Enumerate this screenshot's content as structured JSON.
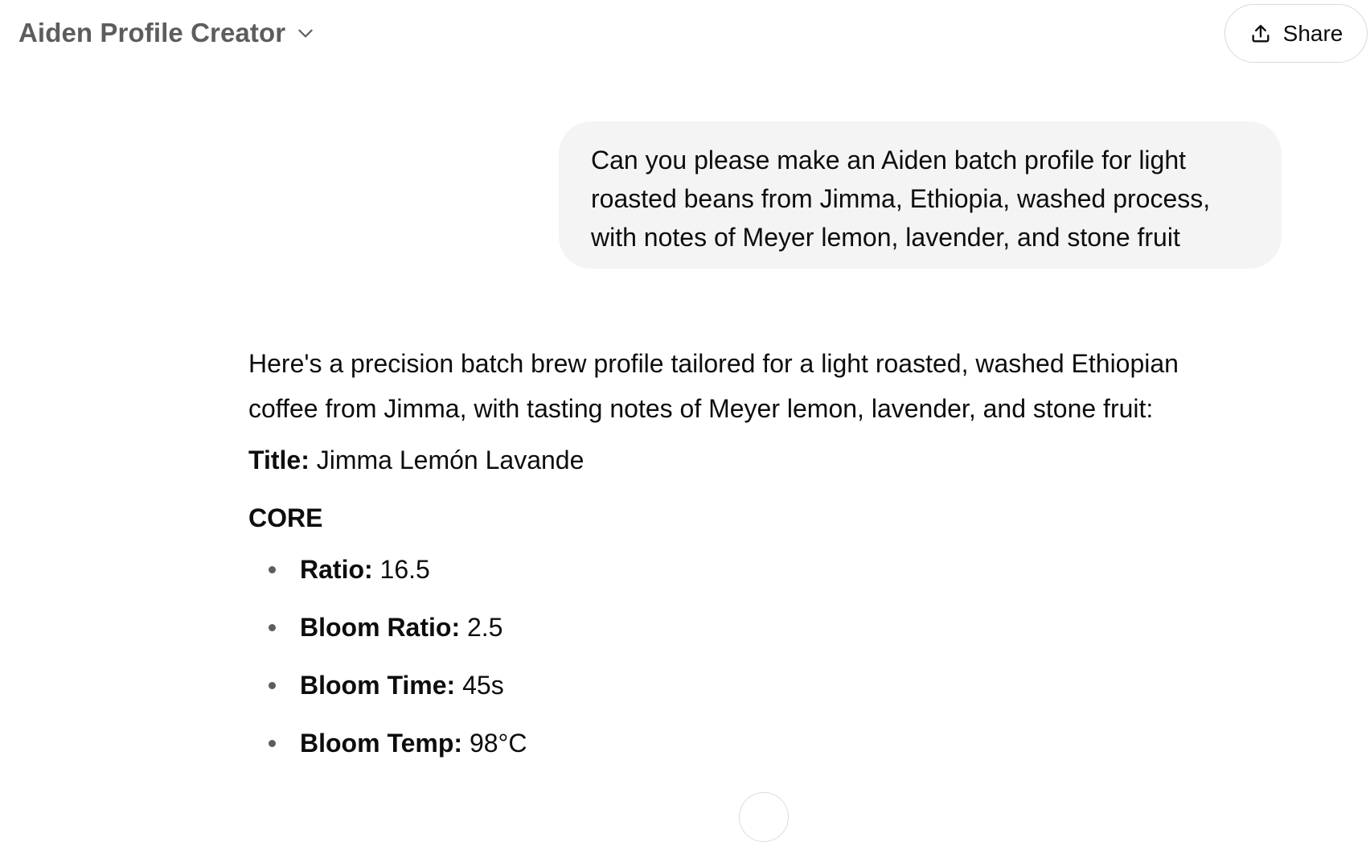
{
  "header": {
    "title": "Aiden Profile Creator",
    "share_label": "Share"
  },
  "conversation": {
    "user_message": "Can you please make an Aiden batch profile for light roasted beans from Jimma, Ethiopia, washed process, with notes of Meyer lemon, lavender, and stone fruit",
    "assistant": {
      "intro": "Here's a precision batch brew profile tailored for a light roasted, washed Ethiopian coffee from Jimma, with tasting notes of Meyer lemon, lavender, and stone fruit:",
      "title_key": "Title:",
      "title_value": "Jimma Lemón Lavande",
      "section_heading": "CORE",
      "specs": [
        {
          "key": "Ratio:",
          "value": "16.5"
        },
        {
          "key": "Bloom Ratio:",
          "value": "2.5"
        },
        {
          "key": "Bloom Time:",
          "value": "45s"
        },
        {
          "key": "Bloom Temp:",
          "value": "98°C"
        }
      ]
    }
  },
  "icons": {
    "title_dropdown": "chevron-down-icon",
    "share": "share-upload-icon",
    "scroll": "scroll-down-icon"
  },
  "colors": {
    "user_bubble_bg": "#f4f4f4",
    "title_text": "#5d5d5d",
    "text": "#0d0d0d"
  }
}
